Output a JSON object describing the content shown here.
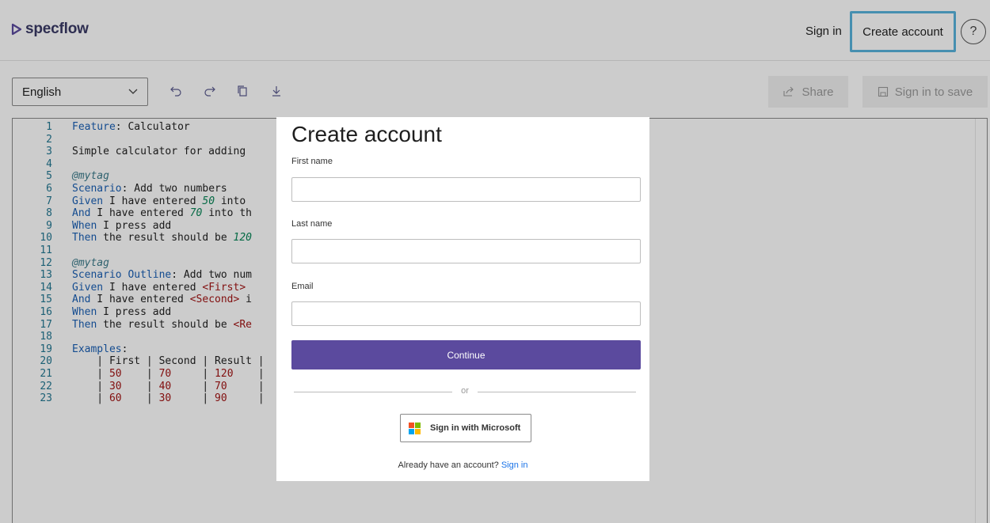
{
  "header": {
    "brand": "specflow",
    "sign_in": "Sign in",
    "create_account": "Create account",
    "help_glyph": "?"
  },
  "toolbar": {
    "language": "English",
    "share_label": "Share",
    "save_label": "Sign in to save"
  },
  "editor": {
    "lines": [
      {
        "n": "1",
        "parts": [
          [
            "kw",
            "Feature"
          ],
          [
            "txt",
            ": Calculator"
          ]
        ]
      },
      {
        "n": "2",
        "parts": []
      },
      {
        "n": "3",
        "parts": [
          [
            "txt",
            "Simple calculator for adding"
          ]
        ]
      },
      {
        "n": "4",
        "parts": []
      },
      {
        "n": "5",
        "parts": [
          [
            "tag",
            "@mytag"
          ]
        ]
      },
      {
        "n": "6",
        "parts": [
          [
            "kw",
            "Scenario"
          ],
          [
            "txt",
            ": Add two numbers"
          ]
        ]
      },
      {
        "n": "7",
        "parts": [
          [
            "kw",
            "Given"
          ],
          [
            "txt",
            " I have entered "
          ],
          [
            "num",
            "50"
          ],
          [
            "txt",
            " into"
          ]
        ]
      },
      {
        "n": "8",
        "parts": [
          [
            "kw",
            "And"
          ],
          [
            "txt",
            " I have entered "
          ],
          [
            "num",
            "70"
          ],
          [
            "txt",
            " into th"
          ]
        ]
      },
      {
        "n": "9",
        "parts": [
          [
            "kw",
            "When"
          ],
          [
            "txt",
            " I press add"
          ]
        ]
      },
      {
        "n": "10",
        "parts": [
          [
            "kw",
            "Then"
          ],
          [
            "txt",
            " the result should be "
          ],
          [
            "num",
            "120"
          ]
        ]
      },
      {
        "n": "11",
        "parts": []
      },
      {
        "n": "12",
        "parts": [
          [
            "tag",
            "@mytag"
          ]
        ]
      },
      {
        "n": "13",
        "parts": [
          [
            "kw",
            "Scenario Outline"
          ],
          [
            "txt",
            ": Add two num"
          ]
        ]
      },
      {
        "n": "14",
        "parts": [
          [
            "kw",
            "Given"
          ],
          [
            "txt",
            " I have entered "
          ],
          [
            "ph",
            "<First>"
          ]
        ]
      },
      {
        "n": "15",
        "parts": [
          [
            "kw",
            "And"
          ],
          [
            "txt",
            " I have entered "
          ],
          [
            "ph",
            "<Second>"
          ],
          [
            "txt",
            " i"
          ]
        ]
      },
      {
        "n": "16",
        "parts": [
          [
            "kw",
            "When"
          ],
          [
            "txt",
            " I press add"
          ]
        ]
      },
      {
        "n": "17",
        "parts": [
          [
            "kw",
            "Then"
          ],
          [
            "txt",
            " the result should be "
          ],
          [
            "ph",
            "<Re"
          ]
        ]
      },
      {
        "n": "18",
        "parts": []
      },
      {
        "n": "19",
        "parts": [
          [
            "kw",
            "Examples"
          ],
          [
            "txt",
            ":"
          ]
        ]
      },
      {
        "n": "20",
        "parts": [
          [
            "tbl",
            "    | First | Second | Result |"
          ]
        ]
      },
      {
        "n": "21",
        "parts": [
          [
            "tbl",
            "    | "
          ],
          [
            "tblnum",
            "50"
          ],
          [
            "tbl",
            "    | "
          ],
          [
            "tblnum",
            "70"
          ],
          [
            "tbl",
            "     | "
          ],
          [
            "tblnum",
            "120"
          ],
          [
            "tbl",
            "    |"
          ]
        ]
      },
      {
        "n": "22",
        "parts": [
          [
            "tbl",
            "    | "
          ],
          [
            "tblnum",
            "30"
          ],
          [
            "tbl",
            "    | "
          ],
          [
            "tblnum",
            "40"
          ],
          [
            "tbl",
            "     | "
          ],
          [
            "tblnum",
            "70"
          ],
          [
            "tbl",
            "     |"
          ]
        ]
      },
      {
        "n": "23",
        "parts": [
          [
            "tbl",
            "    | "
          ],
          [
            "tblnum",
            "60"
          ],
          [
            "tbl",
            "    | "
          ],
          [
            "tblnum",
            "30"
          ],
          [
            "tbl",
            "     | "
          ],
          [
            "tblnum",
            "90"
          ],
          [
            "tbl",
            "     |"
          ]
        ]
      }
    ]
  },
  "modal": {
    "title": "Create account",
    "first_name_label": "First name",
    "last_name_label": "Last name",
    "email_label": "Email",
    "continue_label": "Continue",
    "or_label": "or",
    "microsoft_label": "Sign in with Microsoft",
    "account_prompt": "Already have an account?",
    "account_link": "Sign in"
  },
  "colors": {
    "accent": "#5b4a9e",
    "highlight_border": "#58b3dd",
    "ms_red": "#f25022",
    "ms_green": "#7fba00",
    "ms_blue": "#00a4ef",
    "ms_yellow": "#ffb900"
  }
}
